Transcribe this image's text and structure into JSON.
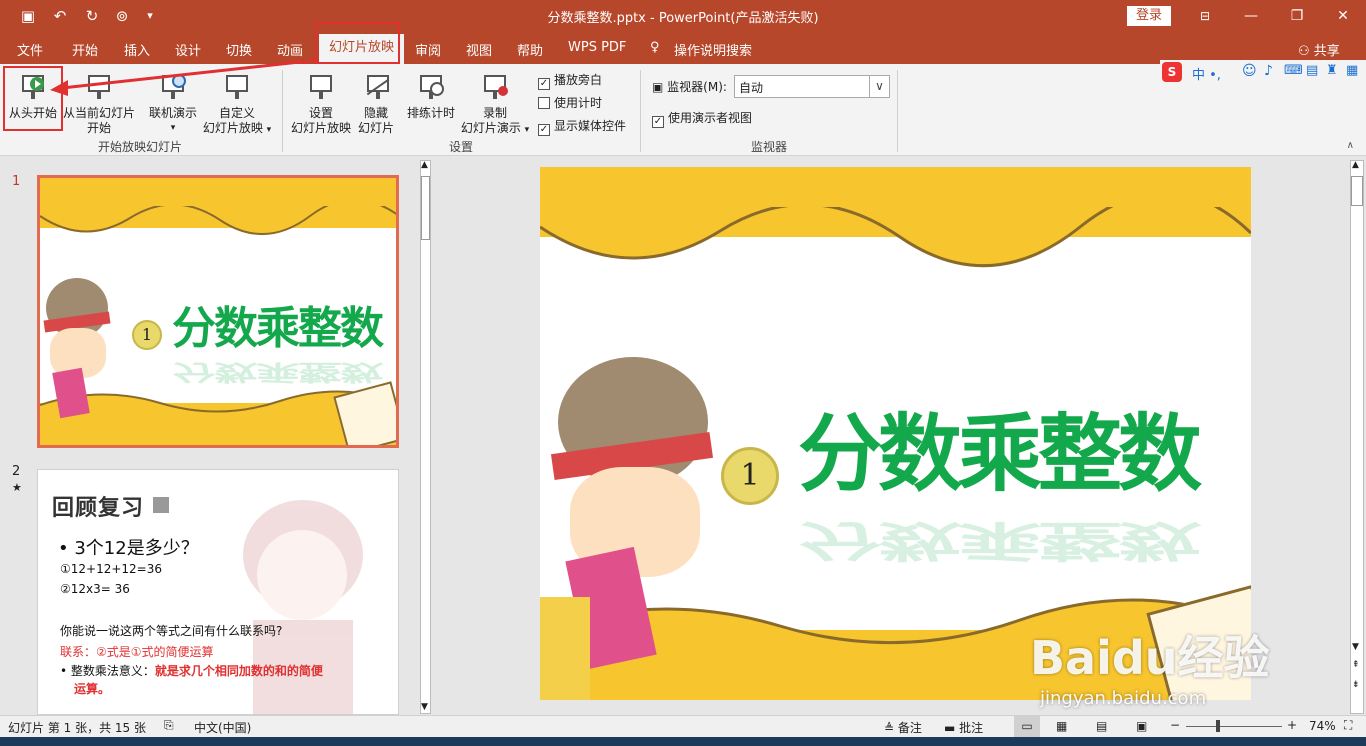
{
  "window": {
    "title": "分数乘整数.pptx  -  PowerPoint(产品激活失败)",
    "login_label": "登录",
    "share_label": "共享"
  },
  "tabs": [
    {
      "label": "文件"
    },
    {
      "label": "开始"
    },
    {
      "label": "插入"
    },
    {
      "label": "设计"
    },
    {
      "label": "切换"
    },
    {
      "label": "动画"
    },
    {
      "label": "幻灯片放映"
    },
    {
      "label": "审阅"
    },
    {
      "label": "视图"
    },
    {
      "label": "帮助"
    },
    {
      "label": "WPS PDF"
    },
    {
      "label": "操作说明搜索"
    }
  ],
  "ribbon": {
    "start_group": {
      "label": "开始放映幻灯片",
      "from_beginning": "从头开始",
      "from_current_1": "从当前幻灯片",
      "from_current_2": "开始",
      "online_present": "联机演示",
      "custom_1": "自定义",
      "custom_2": "幻灯片放映"
    },
    "setup_group": {
      "label": "设置",
      "setup_1": "设置",
      "setup_2": "幻灯片放映",
      "hide_1": "隐藏",
      "hide_2": "幻灯片",
      "rehearse": "排练计时",
      "record_1": "录制",
      "record_2": "幻灯片演示",
      "chk_narration": "播放旁白",
      "chk_timing": "使用计时",
      "chk_media": "显示媒体控件"
    },
    "monitor_group": {
      "label": "监视器",
      "monitor_label": "监视器(M):",
      "monitor_value": "自动",
      "presenter_view": "使用演示者视图"
    }
  },
  "slides": {
    "slide1": {
      "number": "1",
      "title": "分数乘整数",
      "badge": "1"
    },
    "slide2": {
      "number": "2",
      "star": "★",
      "heading": "回顾复习",
      "q": "• 3个12是多少？",
      "a1": "①12+12+12=36",
      "a2": "②12x3= 36",
      "prompt": "你能说一说这两个等式之间有什么联系吗?",
      "link": "联系：②式是①式的简便运算",
      "bullet_label": "• 整数乘法意义：",
      "bullet_bold_1": "就是求几个相同加数的和的简便",
      "bullet_bold_2": "运算。"
    }
  },
  "status": {
    "slide_info": "幻灯片 第 1 张，共 15 张",
    "language": "中文(中国)",
    "notes": "备注",
    "comments": "批注",
    "zoom": "74%"
  },
  "watermark": {
    "main": "Baidu经验",
    "sub": "jingyan.baidu.com"
  },
  "ime": {
    "chars": "中 •,"
  },
  "colors": {
    "accent": "#b7472a",
    "title_green": "#13a84b",
    "highlight_red": "#e03030"
  }
}
